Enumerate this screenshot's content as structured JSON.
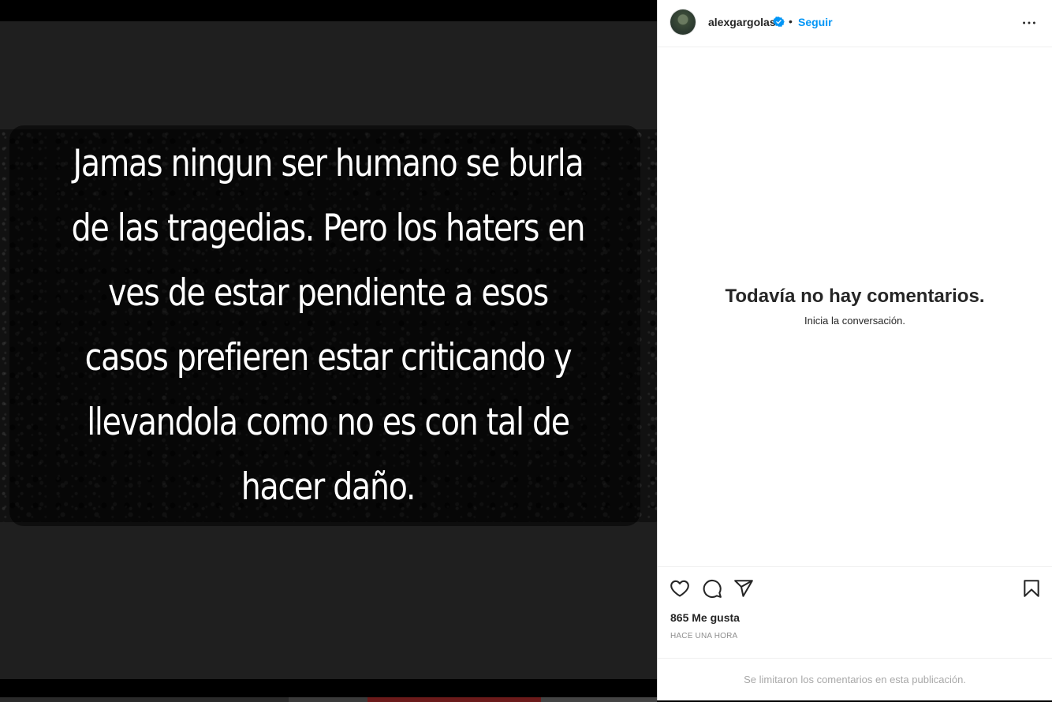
{
  "media": {
    "caption": "Jamas ningun ser humano se burla de las tragedias. Pero los haters en ves de estar pendiente a esos casos prefieren estar criticando y llevandola como no es con tal de hacer daño."
  },
  "header": {
    "username": "alexgargolas",
    "verified": true,
    "separator": "•",
    "follow_label": "Seguir",
    "more_icon": "more-horizontal-icon"
  },
  "comments": {
    "empty_title": "Todavía no hay comentarios.",
    "empty_subtitle": "Inicia la conversación."
  },
  "actions": {
    "icons": [
      "heart-icon",
      "comment-icon",
      "share-icon",
      "bookmark-icon"
    ],
    "likes": "865 Me gusta",
    "timestamp": "HACE UNA HORA"
  },
  "footer": {
    "limited_note": "Se limitaron los comentarios en esta publicación."
  },
  "colors": {
    "accent": "#0095f6",
    "verified": "#0095f6",
    "text": "#262626",
    "muted": "#8e8e8e"
  }
}
